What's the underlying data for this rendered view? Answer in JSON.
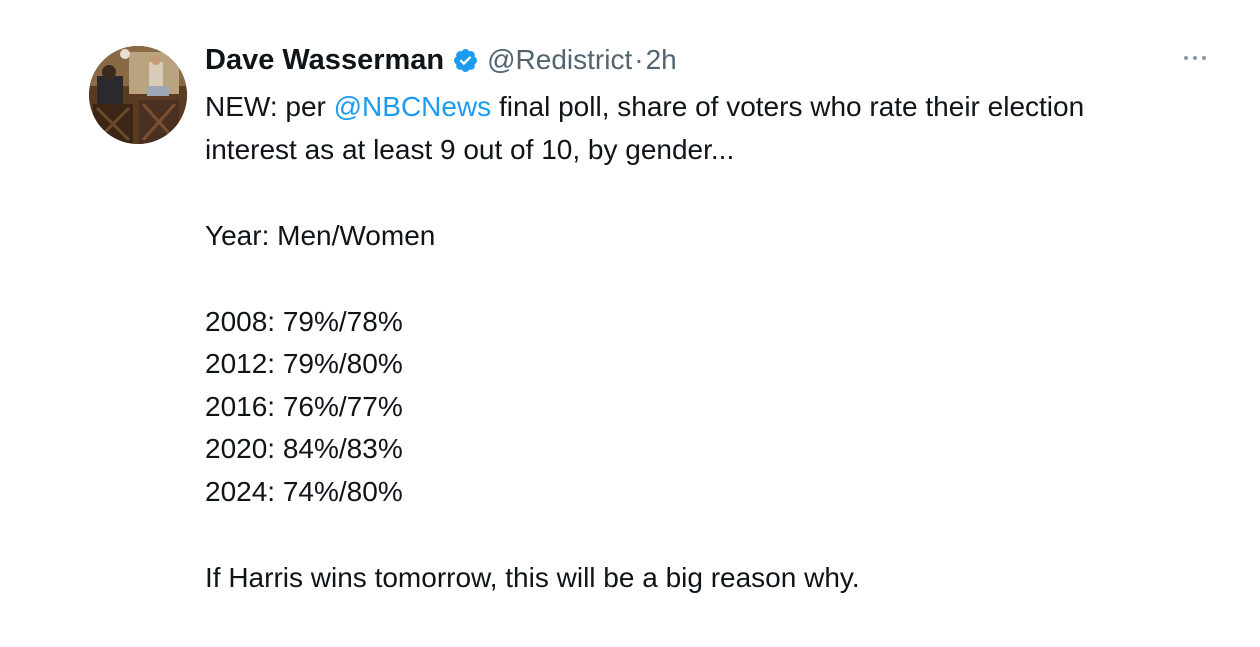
{
  "tweet": {
    "author": {
      "display_name": "Dave Wasserman",
      "handle": "@Redistrict",
      "separator": "·",
      "time": "2h",
      "verified_icon": "verified-badge-icon"
    },
    "more_icon": "more-options-icon",
    "text": {
      "line1_prefix": "NEW: per ",
      "mention": "@NBCNews",
      "line1_suffix": " final poll, share of voters who rate their election",
      "line2": "interest as at least 9 out of 10, by gender...",
      "header_line": "Year: Men/Women",
      "rows": [
        "2008: 79%/78%",
        "2012: 79%/80%",
        "2016: 76%/77%",
        "2020: 84%/83%",
        "2024: 74%/80%"
      ],
      "closing": "If Harris wins tomorrow, this will be a big reason why."
    },
    "colors": {
      "text": "#0f1419",
      "secondary": "#536471",
      "link": "#1d9bf0",
      "verified": "#1d9bf0"
    }
  }
}
